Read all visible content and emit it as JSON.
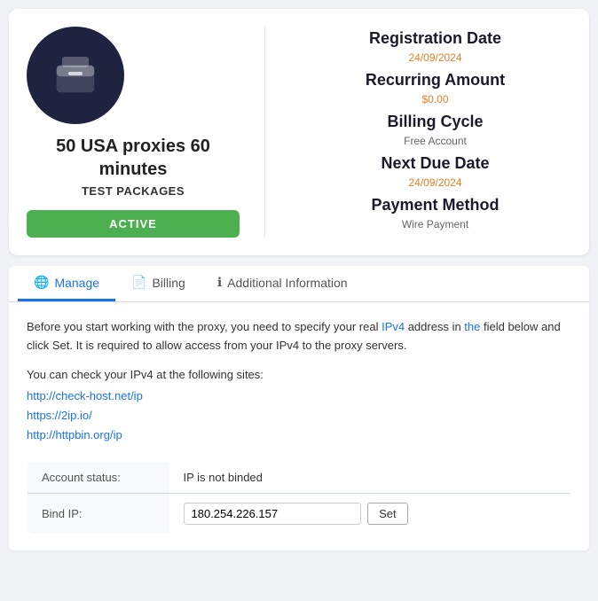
{
  "card": {
    "icon_alt": "box-icon",
    "title": "50 USA proxies 60 minutes",
    "subtitle": "TEST PACKAGES",
    "active_label": "ACTIVE",
    "registration_label": "Registration Date",
    "registration_date": "24/09/2024",
    "recurring_label": "Recurring Amount",
    "recurring_value": "$0.00",
    "billing_label": "Billing Cycle",
    "billing_value": "Free Account",
    "next_due_label": "Next Due Date",
    "next_due_date": "24/09/2024",
    "payment_label": "Payment Method",
    "payment_value": "Wire Payment"
  },
  "tabs": [
    {
      "id": "manage",
      "label": "Manage",
      "icon": "🌐",
      "active": true
    },
    {
      "id": "billing",
      "label": "Billing",
      "icon": "📄",
      "active": false
    },
    {
      "id": "additional",
      "label": "Additional Information",
      "icon": "ℹ",
      "active": false
    }
  ],
  "manage_content": {
    "intro": "Before you start working with the proxy, you need to specify your real IPv4 address in the field below and click Set. It is required to allow access from your IPv4 to the proxy servers.",
    "check_sites_label": "You can check your IPv4 at the following sites:",
    "sites": [
      "http://check-host.net/ip",
      "https://2ip.io/",
      "http://httpbin.org/ip"
    ],
    "account_status_label": "Account status:",
    "account_status_value": "IP is not binded",
    "bind_ip_label": "Bind IP:",
    "bind_ip_value": "180.254.226.157",
    "set_button_label": "Set"
  }
}
